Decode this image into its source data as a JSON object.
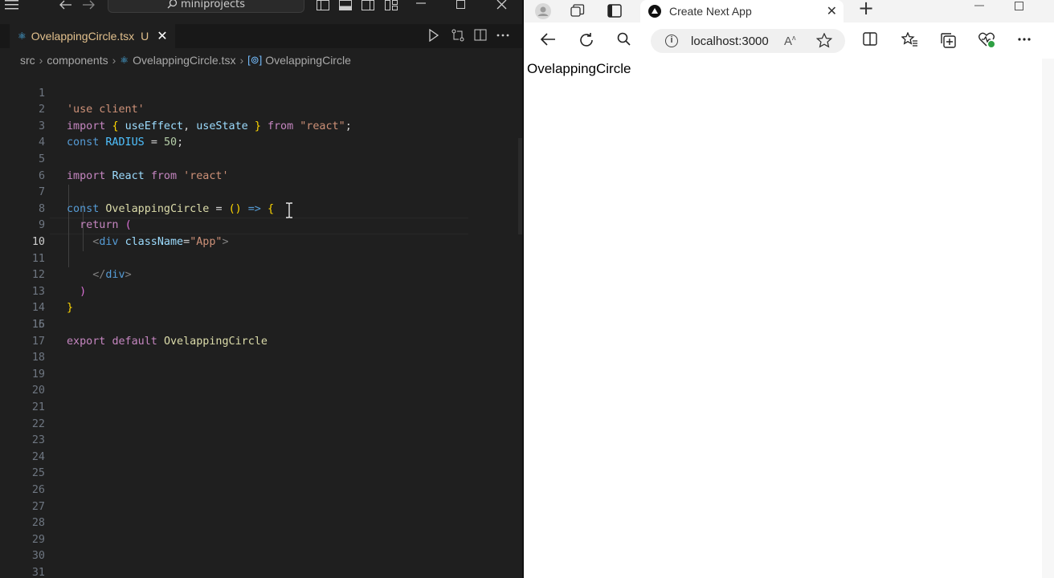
{
  "vscode": {
    "search_text": "miniprojects",
    "tab": {
      "title": "OvelappingCircle.tsx",
      "status": "U",
      "close": "✕"
    },
    "breadcrumb": {
      "items": [
        "src",
        "components",
        "OvelappingCircle.tsx",
        "OvelappingCircle"
      ],
      "separator": "›"
    },
    "active_line": 10,
    "line_numbers": [
      "1",
      "2",
      "3",
      "4",
      "5",
      "6",
      "7",
      "8",
      "9",
      "10",
      "11",
      "12",
      "13",
      "14",
      "15",
      "16",
      "17",
      "18",
      "19",
      "20",
      "21",
      "22",
      "23",
      "24",
      "25",
      "26",
      "27",
      "28",
      "29",
      "30",
      "31"
    ],
    "code": {
      "l1": "'use client'",
      "l2_import": "import",
      "l2_open": "{",
      "l2_useEffect": "useEffect",
      "l2_comma": ",",
      "l2_useState": "useState",
      "l2_close": "}",
      "l2_from": "from",
      "l2_mod": "\"react\"",
      "l2_semi": ";",
      "l3_const": "const",
      "l3_name": "RADIUS",
      "l3_eq": "=",
      "l3_val": "50",
      "l3_semi": ";",
      "l5_import": "import",
      "l5_name": "React",
      "l5_from": "from",
      "l5_mod": "'react'",
      "l7_const": "const",
      "l7_name": "OvelappingCircle",
      "l7_eq": "=",
      "l7_params": "()",
      "l7_arrow": "=>",
      "l7_brace": "{",
      "l8_return": "return",
      "l8_paren": "(",
      "l9_lt": "<",
      "l9_tag": "div",
      "l9_attr": "className",
      "l9_eq": "=",
      "l9_val": "\"App\"",
      "l9_gt": ">",
      "l11_lt": "</",
      "l11_tag": "div",
      "l11_gt": ">",
      "l12_paren": ")",
      "l13_brace": "}",
      "l15_export": "export",
      "l15_default": "default",
      "l15_name": "OvelappingCircle"
    },
    "colors": {
      "editor_bg": "#1f1f1f",
      "keyword": "#569cd6",
      "string": "#ce9178",
      "modified_file": "#e2c08d"
    }
  },
  "browser": {
    "tab_title": "Create Next App",
    "tab_close": "✕",
    "new_tab": "+",
    "address": "localhost:3000",
    "page_heading": "OvelappingCircle"
  }
}
